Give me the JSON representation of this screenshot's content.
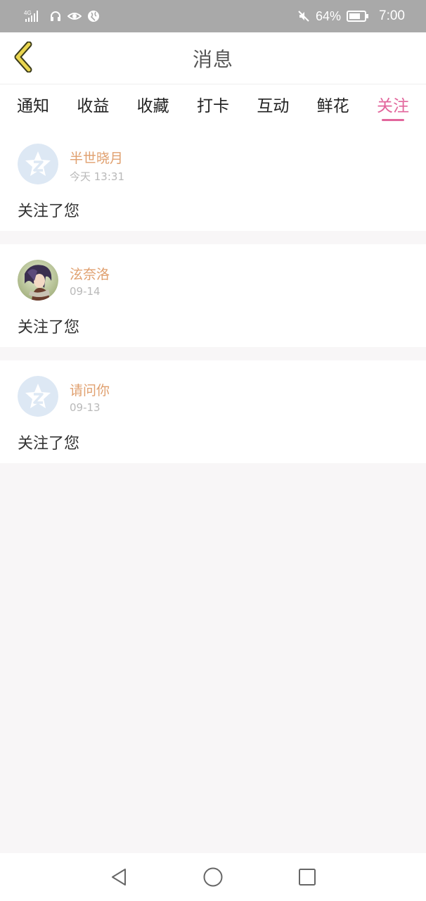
{
  "status_bar": {
    "network": "4G",
    "battery": "64%",
    "time": "7:00",
    "icons": [
      "signal-icon",
      "headset-icon",
      "eye-icon",
      "globe-icon",
      "mute-icon",
      "battery-icon"
    ]
  },
  "header": {
    "title": "消息",
    "back_icon": "chevron-left-icon"
  },
  "tabs": [
    {
      "label": "通知",
      "active": false
    },
    {
      "label": "收益",
      "active": false
    },
    {
      "label": "收藏",
      "active": false
    },
    {
      "label": "打卡",
      "active": false
    },
    {
      "label": "互动",
      "active": false
    },
    {
      "label": "鲜花",
      "active": false
    },
    {
      "label": "关注",
      "active": true
    }
  ],
  "messages": [
    {
      "name": "半世晓月",
      "time": "今天 13:31",
      "text": "关注了您",
      "avatar": "default-star-avatar"
    },
    {
      "name": "泫奈洛",
      "time": "09-14",
      "text": "关注了您",
      "avatar": "anime-character-avatar"
    },
    {
      "name": "请问你",
      "time": "09-13",
      "text": "关注了您",
      "avatar": "default-star-avatar"
    }
  ],
  "colors": {
    "accent": "#e2669c",
    "username": "#e0a06f",
    "back_icon": "#e9d54f"
  },
  "bottom_nav": [
    "back-triangle-icon",
    "home-circle-icon",
    "recents-square-icon"
  ]
}
